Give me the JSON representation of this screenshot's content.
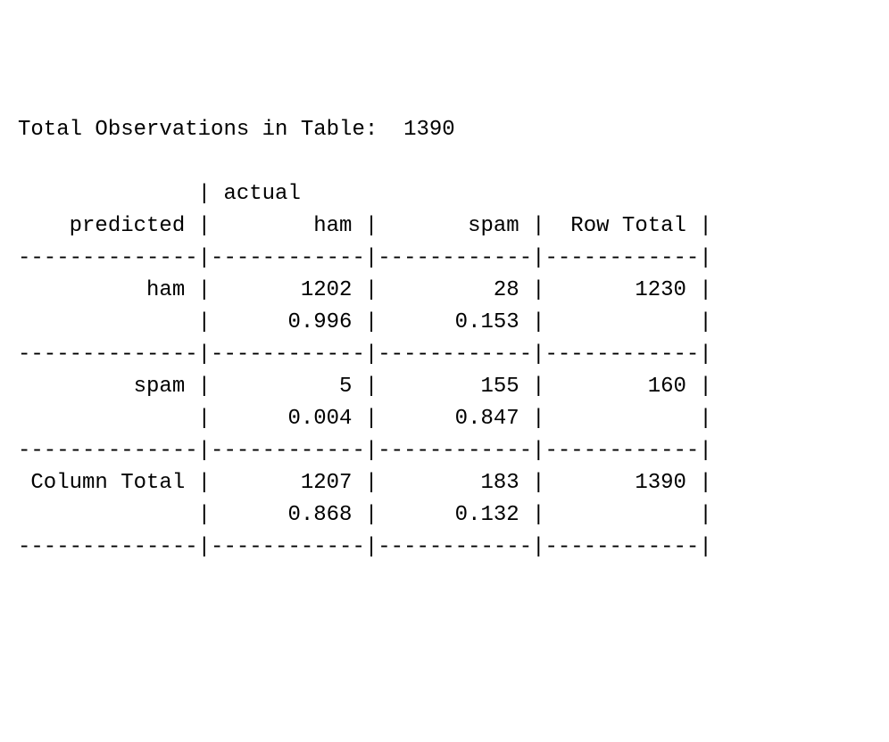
{
  "title": "Total Observations in Table:  1390",
  "chart_data": {
    "type": "table",
    "title": "Confusion matrix (predicted × actual)",
    "row_variable": "predicted",
    "col_variable": "actual",
    "row_labels": [
      "ham",
      "spam"
    ],
    "col_labels": [
      "ham",
      "spam"
    ],
    "counts": [
      [
        1202,
        28
      ],
      [
        5,
        155
      ]
    ],
    "col_proportions": [
      [
        0.996,
        0.153
      ],
      [
        0.004,
        0.847
      ]
    ],
    "row_totals": [
      1230,
      160
    ],
    "col_totals": [
      1207,
      183
    ],
    "col_total_proportions": [
      0.868,
      0.132
    ],
    "grand_total": 1390
  },
  "lines": {
    "l0": "Total Observations in Table:  1390",
    "l1": "",
    "l2": "              | actual",
    "l3": "    predicted |        ham |       spam |  Row Total |",
    "l4": "--------------|------------|------------|------------|",
    "l5": "          ham |       1202 |         28 |       1230 |",
    "l6": "              |      0.996 |      0.153 |            |",
    "l7": "--------------|------------|------------|------------|",
    "l8": "         spam |          5 |        155 |        160 |",
    "l9": "              |      0.004 |      0.847 |            |",
    "l10": "--------------|------------|------------|------------|",
    "l11": " Column Total |       1207 |        183 |       1390 |",
    "l12": "              |      0.868 |      0.132 |            |",
    "l13": "--------------|------------|------------|------------|"
  }
}
